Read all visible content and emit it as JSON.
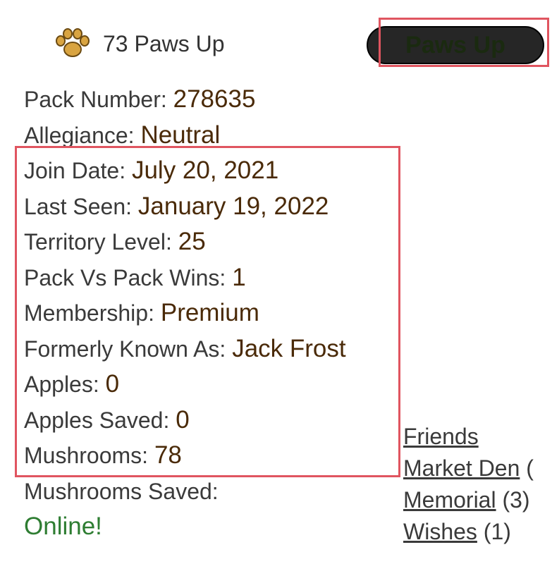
{
  "header": {
    "paws_count_text": "73 Paws Up",
    "paws_up_button_label": "Paws Up"
  },
  "stats": [
    {
      "label": "Pack Number: ",
      "value": "278635"
    },
    {
      "label": "Allegiance: ",
      "value": "Neutral"
    },
    {
      "label": "Join Date: ",
      "value": "July 20, 2021"
    },
    {
      "label": "Last Seen: ",
      "value": "January 19, 2022"
    },
    {
      "label": "Territory Level: ",
      "value": "25"
    },
    {
      "label": "Pack Vs Pack Wins: ",
      "value": "1"
    },
    {
      "label": "Membership: ",
      "value": "Premium"
    },
    {
      "label": "Formerly Known As: ",
      "value": "Jack Frost"
    },
    {
      "label": "Apples: ",
      "value": "0"
    },
    {
      "label": "Apples Saved: ",
      "value": "0"
    },
    {
      "label": "Mushrooms: ",
      "value": "78"
    },
    {
      "label": "Mushrooms Saved:",
      "value": ""
    }
  ],
  "status": {
    "online_text": "Online!"
  },
  "links": [
    {
      "label": "Friends",
      "count": ""
    },
    {
      "label": "Market Den",
      "count": " ("
    },
    {
      "label": "Memorial",
      "count": " (3)"
    },
    {
      "label": "Wishes",
      "count": " (1)"
    }
  ],
  "colors": {
    "highlight": "#e05560",
    "label_text": "#3a3a3a",
    "value_text": "#4a2a08",
    "online_text": "#2e7d32",
    "button_bg": "#262626",
    "paw_icon": "#d9a441"
  },
  "icons": {
    "paw": "paw-icon"
  }
}
